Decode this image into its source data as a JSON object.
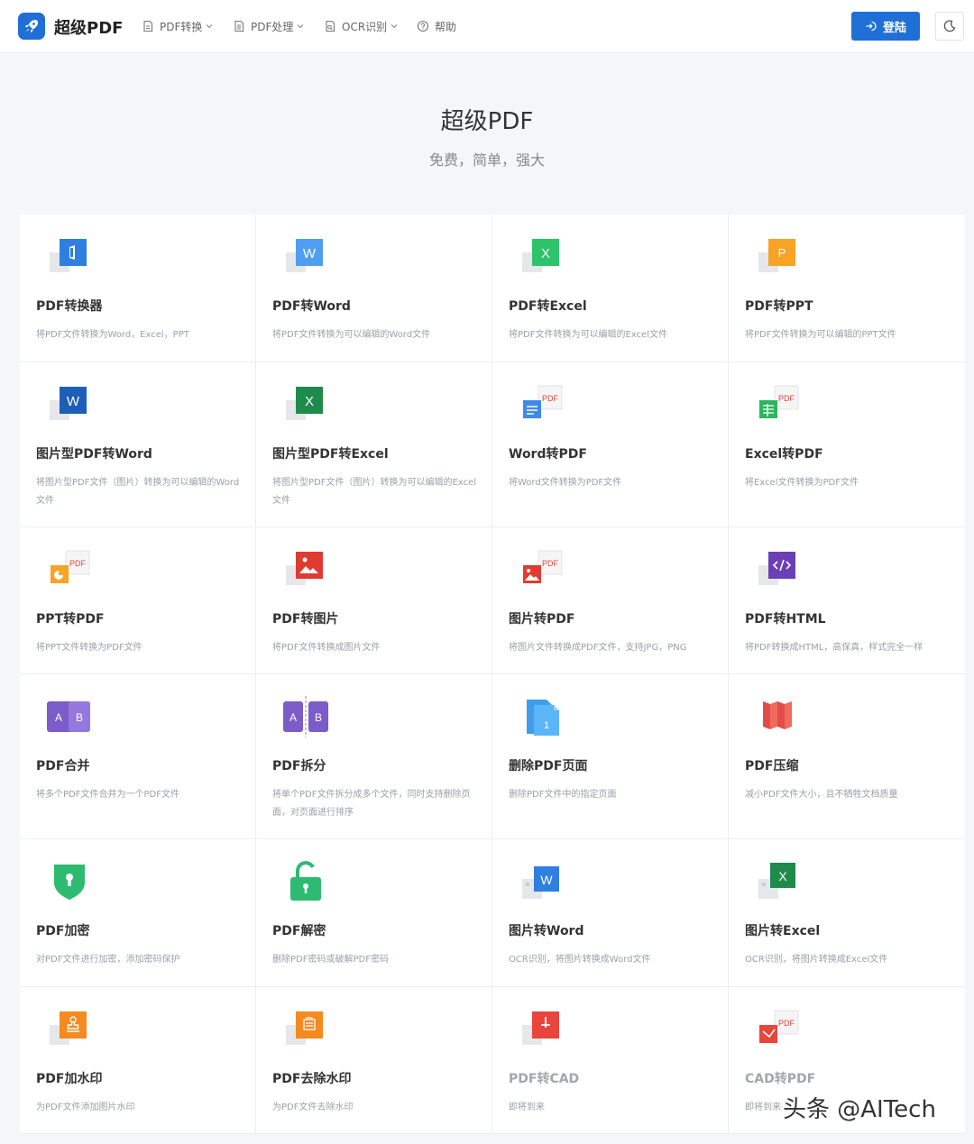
{
  "header": {
    "brand": "超级PDF",
    "nav": [
      {
        "label": "PDF转换",
        "icon": "file-icon"
      },
      {
        "label": "PDF处理",
        "icon": "file-list-icon"
      },
      {
        "label": "OCR识别",
        "icon": "file-scan-icon"
      },
      {
        "label": "帮助",
        "icon": "help-circle-icon"
      }
    ],
    "login_label": "登陆",
    "theme_icon": "moon-icon",
    "accent_color": "#1f6fd6"
  },
  "hero": {
    "title": "超级PDF",
    "subtitle": "免费，简单，强大"
  },
  "tools": [
    [
      {
        "title": "PDF转换器",
        "desc": "将PDF文件转换为Word，Excel，PPT",
        "icon": "office-icon"
      },
      {
        "title": "PDF转Word",
        "desc": "将PDF文件转换为可以编辑的Word文件",
        "icon": "word-icon"
      },
      {
        "title": "PDF转Excel",
        "desc": "将PDF文件转换为可以编辑的Excel文件",
        "icon": "excel-icon"
      },
      {
        "title": "PDF转PPT",
        "desc": "将PDF文件转换为可以编辑的PPT文件",
        "icon": "ppt-icon"
      }
    ],
    [
      {
        "title": "图片型PDF转Word",
        "desc": "将图片型PDF文件（图片）转换为可以编辑的Word文件",
        "icon": "word-dark-icon"
      },
      {
        "title": "图片型PDF转Excel",
        "desc": "将图片型PDF文件（图片）转换为可以编辑的Excel文件",
        "icon": "excel-dark-icon"
      },
      {
        "title": "Word转PDF",
        "desc": "将Word文件转换为PDF文件",
        "icon": "word-to-pdf-icon"
      },
      {
        "title": "Excel转PDF",
        "desc": "将Excel文件转换为PDF文件",
        "icon": "excel-to-pdf-icon"
      }
    ],
    [
      {
        "title": "PPT转PDF",
        "desc": "将PPT文件转换为PDF文件",
        "icon": "ppt-to-pdf-icon"
      },
      {
        "title": "PDF转图片",
        "desc": "将PDF文件转换成图片文件",
        "icon": "image-icon"
      },
      {
        "title": "图片转PDF",
        "desc": "将图片文件转换成PDF文件，支持JPG，PNG",
        "icon": "image-to-pdf-icon"
      },
      {
        "title": "PDF转HTML",
        "desc": "将PDF转换成HTML，高保真，样式完全一样",
        "icon": "html-code-icon"
      }
    ],
    [
      {
        "title": "PDF合并",
        "desc": "将多个PDF文件合并为一个PDF文件",
        "icon": "merge-ab-icon",
        "labels": [
          "A",
          "B"
        ]
      },
      {
        "title": "PDF拆分",
        "desc": "将单个PDF文件拆分成多个文件，同时支持删除页面，对页面进行排序",
        "icon": "split-ab-icon",
        "labels": [
          "A",
          "B"
        ]
      },
      {
        "title": "删除PDF页面",
        "desc": "删除PDF文件中的指定页面",
        "icon": "delete-pages-icon"
      },
      {
        "title": "PDF压缩",
        "desc": "减小PDF文件大小，且不牺牲文档质量",
        "icon": "compress-icon"
      }
    ],
    [
      {
        "title": "PDF加密",
        "desc": "对PDF文件进行加密，添加密码保护",
        "icon": "shield-lock-icon"
      },
      {
        "title": "PDF解密",
        "desc": "删除PDF密码或破解PDF密码",
        "icon": "unlock-icon"
      },
      {
        "title": "图片转Word",
        "desc": "OCR识别，将图片转换成Word文件",
        "icon": "ocr-word-icon"
      },
      {
        "title": "图片转Excel",
        "desc": "OCR识别，将图片转换成Excel文件",
        "icon": "ocr-excel-icon"
      }
    ],
    [
      {
        "title": "PDF加水印",
        "desc": "为PDF文件添加图片水印",
        "icon": "stamp-icon"
      },
      {
        "title": "PDF去除水印",
        "desc": "为PDF文件去除水印",
        "icon": "remove-stamp-icon"
      },
      {
        "title": "PDF转CAD",
        "desc": "即将到来",
        "icon": "cad-icon",
        "disabled": true
      },
      {
        "title": "CAD转PDF",
        "desc": "即将到来",
        "icon": "cad-to-pdf-icon",
        "disabled": true
      }
    ]
  ],
  "watermark": "头条 @AITech"
}
